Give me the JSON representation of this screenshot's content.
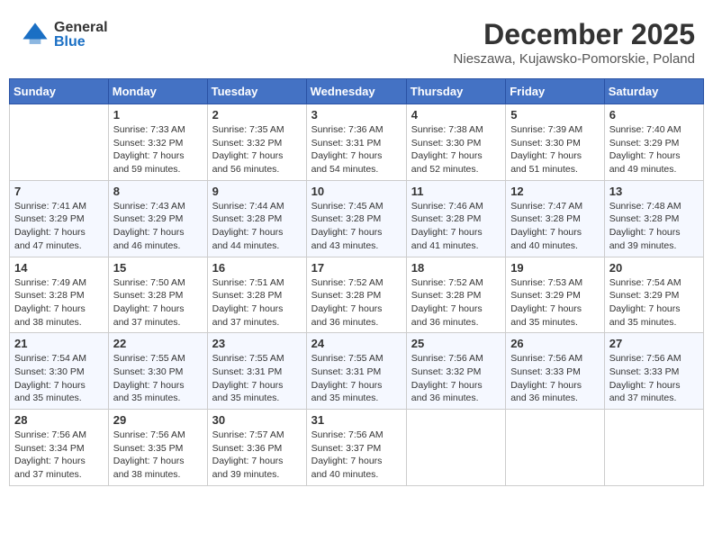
{
  "header": {
    "logo_general": "General",
    "logo_blue": "Blue",
    "month_year": "December 2025",
    "location": "Nieszawa, Kujawsko-Pomorskie, Poland"
  },
  "days_of_week": [
    "Sunday",
    "Monday",
    "Tuesday",
    "Wednesday",
    "Thursday",
    "Friday",
    "Saturday"
  ],
  "weeks": [
    [
      {
        "day": "",
        "info": ""
      },
      {
        "day": "1",
        "info": "Sunrise: 7:33 AM\nSunset: 3:32 PM\nDaylight: 7 hours\nand 59 minutes."
      },
      {
        "day": "2",
        "info": "Sunrise: 7:35 AM\nSunset: 3:32 PM\nDaylight: 7 hours\nand 56 minutes."
      },
      {
        "day": "3",
        "info": "Sunrise: 7:36 AM\nSunset: 3:31 PM\nDaylight: 7 hours\nand 54 minutes."
      },
      {
        "day": "4",
        "info": "Sunrise: 7:38 AM\nSunset: 3:30 PM\nDaylight: 7 hours\nand 52 minutes."
      },
      {
        "day": "5",
        "info": "Sunrise: 7:39 AM\nSunset: 3:30 PM\nDaylight: 7 hours\nand 51 minutes."
      },
      {
        "day": "6",
        "info": "Sunrise: 7:40 AM\nSunset: 3:29 PM\nDaylight: 7 hours\nand 49 minutes."
      }
    ],
    [
      {
        "day": "7",
        "info": "Sunrise: 7:41 AM\nSunset: 3:29 PM\nDaylight: 7 hours\nand 47 minutes."
      },
      {
        "day": "8",
        "info": "Sunrise: 7:43 AM\nSunset: 3:29 PM\nDaylight: 7 hours\nand 46 minutes."
      },
      {
        "day": "9",
        "info": "Sunrise: 7:44 AM\nSunset: 3:28 PM\nDaylight: 7 hours\nand 44 minutes."
      },
      {
        "day": "10",
        "info": "Sunrise: 7:45 AM\nSunset: 3:28 PM\nDaylight: 7 hours\nand 43 minutes."
      },
      {
        "day": "11",
        "info": "Sunrise: 7:46 AM\nSunset: 3:28 PM\nDaylight: 7 hours\nand 41 minutes."
      },
      {
        "day": "12",
        "info": "Sunrise: 7:47 AM\nSunset: 3:28 PM\nDaylight: 7 hours\nand 40 minutes."
      },
      {
        "day": "13",
        "info": "Sunrise: 7:48 AM\nSunset: 3:28 PM\nDaylight: 7 hours\nand 39 minutes."
      }
    ],
    [
      {
        "day": "14",
        "info": "Sunrise: 7:49 AM\nSunset: 3:28 PM\nDaylight: 7 hours\nand 38 minutes."
      },
      {
        "day": "15",
        "info": "Sunrise: 7:50 AM\nSunset: 3:28 PM\nDaylight: 7 hours\nand 37 minutes."
      },
      {
        "day": "16",
        "info": "Sunrise: 7:51 AM\nSunset: 3:28 PM\nDaylight: 7 hours\nand 37 minutes."
      },
      {
        "day": "17",
        "info": "Sunrise: 7:52 AM\nSunset: 3:28 PM\nDaylight: 7 hours\nand 36 minutes."
      },
      {
        "day": "18",
        "info": "Sunrise: 7:52 AM\nSunset: 3:28 PM\nDaylight: 7 hours\nand 36 minutes."
      },
      {
        "day": "19",
        "info": "Sunrise: 7:53 AM\nSunset: 3:29 PM\nDaylight: 7 hours\nand 35 minutes."
      },
      {
        "day": "20",
        "info": "Sunrise: 7:54 AM\nSunset: 3:29 PM\nDaylight: 7 hours\nand 35 minutes."
      }
    ],
    [
      {
        "day": "21",
        "info": "Sunrise: 7:54 AM\nSunset: 3:30 PM\nDaylight: 7 hours\nand 35 minutes."
      },
      {
        "day": "22",
        "info": "Sunrise: 7:55 AM\nSunset: 3:30 PM\nDaylight: 7 hours\nand 35 minutes."
      },
      {
        "day": "23",
        "info": "Sunrise: 7:55 AM\nSunset: 3:31 PM\nDaylight: 7 hours\nand 35 minutes."
      },
      {
        "day": "24",
        "info": "Sunrise: 7:55 AM\nSunset: 3:31 PM\nDaylight: 7 hours\nand 35 minutes."
      },
      {
        "day": "25",
        "info": "Sunrise: 7:56 AM\nSunset: 3:32 PM\nDaylight: 7 hours\nand 36 minutes."
      },
      {
        "day": "26",
        "info": "Sunrise: 7:56 AM\nSunset: 3:33 PM\nDaylight: 7 hours\nand 36 minutes."
      },
      {
        "day": "27",
        "info": "Sunrise: 7:56 AM\nSunset: 3:33 PM\nDaylight: 7 hours\nand 37 minutes."
      }
    ],
    [
      {
        "day": "28",
        "info": "Sunrise: 7:56 AM\nSunset: 3:34 PM\nDaylight: 7 hours\nand 37 minutes."
      },
      {
        "day": "29",
        "info": "Sunrise: 7:56 AM\nSunset: 3:35 PM\nDaylight: 7 hours\nand 38 minutes."
      },
      {
        "day": "30",
        "info": "Sunrise: 7:57 AM\nSunset: 3:36 PM\nDaylight: 7 hours\nand 39 minutes."
      },
      {
        "day": "31",
        "info": "Sunrise: 7:56 AM\nSunset: 3:37 PM\nDaylight: 7 hours\nand 40 minutes."
      },
      {
        "day": "",
        "info": ""
      },
      {
        "day": "",
        "info": ""
      },
      {
        "day": "",
        "info": ""
      }
    ]
  ]
}
